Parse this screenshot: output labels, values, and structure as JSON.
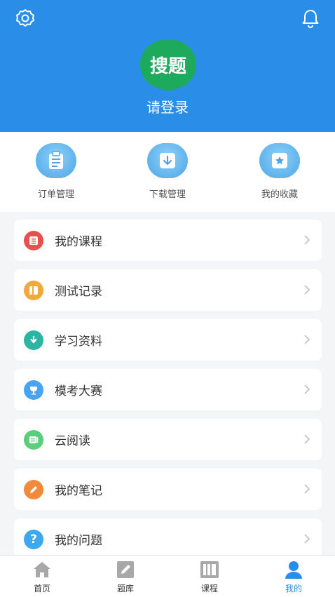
{
  "header": {
    "avatar_text": "搜题",
    "login_text": "请登录",
    "settings_icon": "gear-icon",
    "notification_icon": "bell-icon",
    "background_color": "#2a8ee8"
  },
  "quick_actions": [
    {
      "label": "订单管理",
      "icon": "clipboard-icon"
    },
    {
      "label": "下载管理",
      "icon": "download-icon"
    },
    {
      "label": "我的收藏",
      "icon": "star-icon"
    }
  ],
  "menu": [
    {
      "label": "我的课程",
      "icon": "course-list-icon",
      "color": "#e8504f"
    },
    {
      "label": "测试记录",
      "icon": "test-record-icon",
      "color": "#f2a93b"
    },
    {
      "label": "学习资料",
      "icon": "download-circle-icon",
      "color": "#2cb5a4"
    },
    {
      "label": "模考大赛",
      "icon": "trophy-icon",
      "color": "#4aa3ef"
    },
    {
      "label": "云阅读",
      "icon": "reading-icon",
      "color": "#5ccd7a"
    },
    {
      "label": "我的笔记",
      "icon": "pencil-icon",
      "color": "#f08a3c"
    },
    {
      "label": "我的问题",
      "icon": "question-icon",
      "color": "#3ea8ef"
    }
  ],
  "tabbar": {
    "items": [
      {
        "label": "首页",
        "icon": "home-icon"
      },
      {
        "label": "题库",
        "icon": "edit-icon"
      },
      {
        "label": "课程",
        "icon": "books-icon"
      },
      {
        "label": "我的",
        "icon": "user-icon"
      }
    ],
    "active_index": 3,
    "active_color": "#2a8ee8"
  }
}
